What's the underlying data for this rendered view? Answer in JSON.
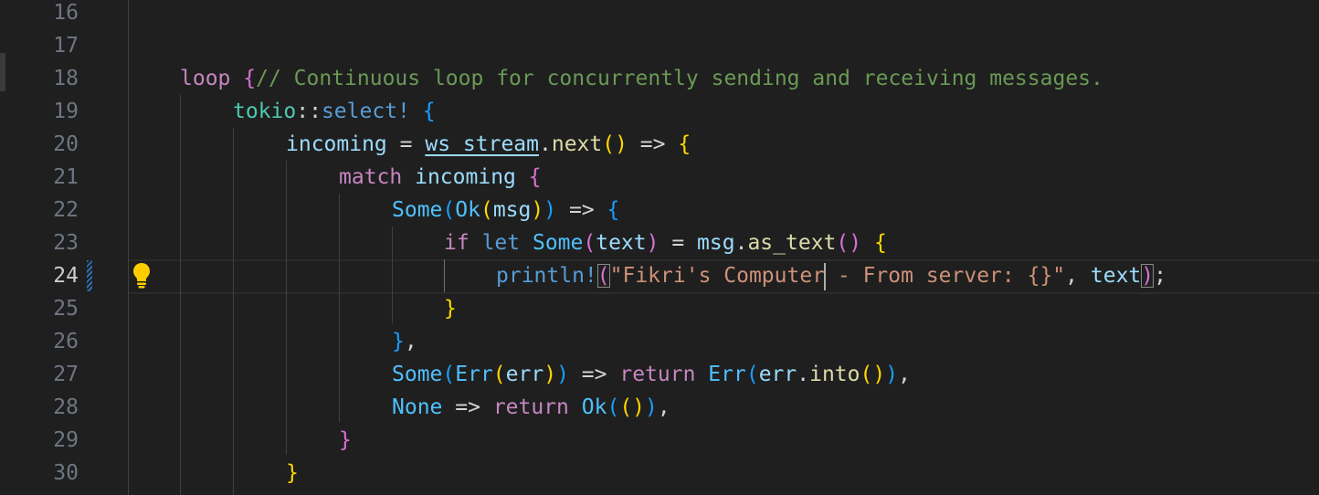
{
  "editor": {
    "line_numbers": [
      "16",
      "17",
      "18",
      "19",
      "20",
      "21",
      "22",
      "23",
      "24",
      "25",
      "26",
      "27",
      "28",
      "29",
      "30"
    ],
    "active_line": "24",
    "code": {
      "l17_comment": "// Continuous loop for concurrently sending and receiving messages.",
      "l18_loop": "loop",
      "l19_tokio": "tokio",
      "l19_select": "select!",
      "l20_incoming": "incoming",
      "l20_ws_stream": "ws_stream",
      "l20_next": "next",
      "l21_match": "match",
      "l21_incoming": "incoming",
      "l22_some": "Some",
      "l22_ok": "Ok",
      "l22_msg": "msg",
      "l23_if": "if",
      "l23_let": "let",
      "l23_some": "Some",
      "l23_text": "text",
      "l23_msg": "msg",
      "l23_as_text": "as_text",
      "l24_println": "println!",
      "l24_str_a": "\"Fikri's Computer",
      "l24_str_b": " - From server: {}\"",
      "l24_text": "text",
      "l27_some": "Some",
      "l27_err": "Err",
      "l27_err_var": "err",
      "l27_return": "return",
      "l27_err2": "Err",
      "l27_err_var2": "err",
      "l27_into": "into",
      "l28_none": "None",
      "l28_return": "return",
      "l28_ok": "Ok"
    }
  },
  "icons": {
    "lightbulb": "lightbulb-icon",
    "dirty_marker": "modified-line-marker"
  },
  "colors": {
    "background": "#1f1f1f",
    "comment": "#6a9955",
    "keyword": "#c586c0",
    "string": "#ce9178",
    "function": "#dcdcaa",
    "variable": "#9cdcfe",
    "type": "#4fc1ff",
    "lightbulb": "#ffcc00"
  }
}
